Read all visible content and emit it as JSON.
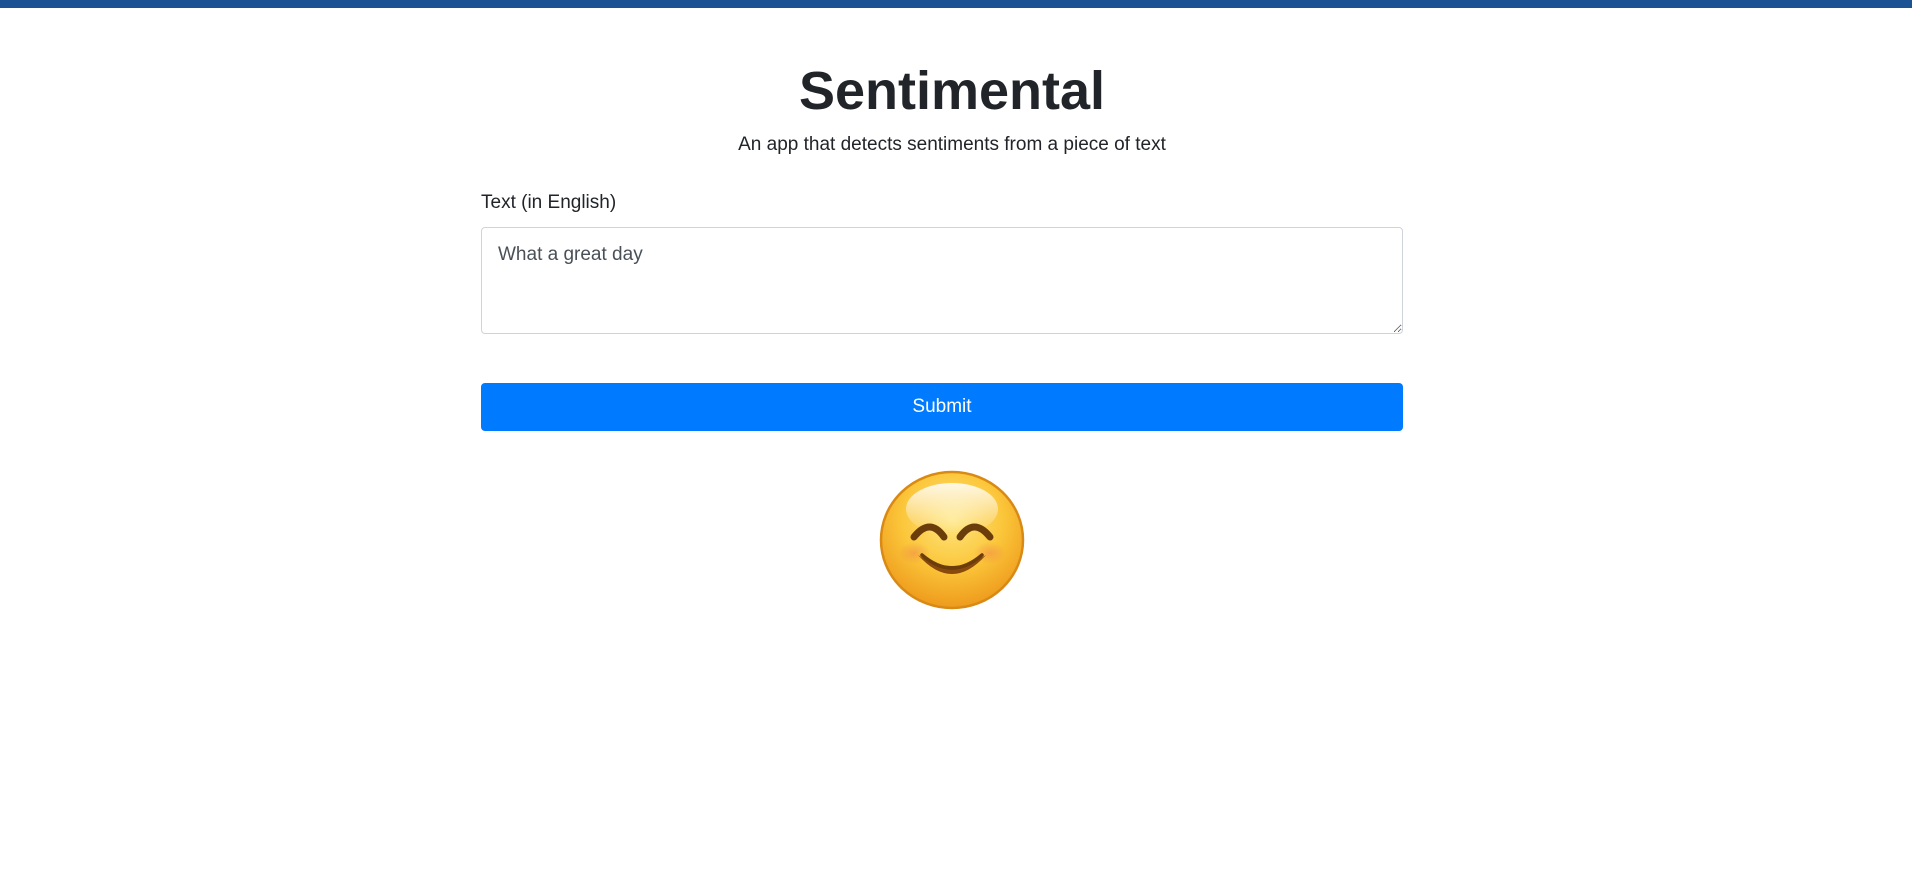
{
  "header": {
    "title": "Sentimental",
    "subtitle": "An app that detects sentiments from a piece of text"
  },
  "form": {
    "text_label": "Text (in English)",
    "text_value": "What a great day",
    "submit_label": "Submit"
  },
  "result": {
    "sentiment_icon": "smiling-face-icon"
  },
  "colors": {
    "top_bar": "#1a5294",
    "button": "#007bff",
    "emoji_face": "#f7b52c",
    "emoji_outline": "#d98a14"
  }
}
